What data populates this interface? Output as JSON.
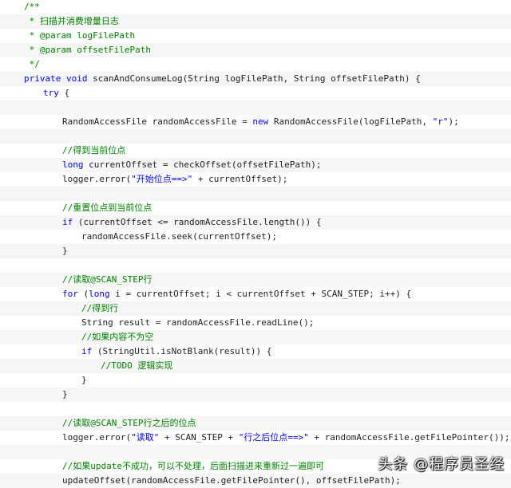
{
  "code_lines": [
    {
      "indent": 30,
      "parts": [
        {
          "text": "/**",
          "cls": "cm"
        }
      ]
    },
    {
      "indent": 30,
      "parts": [
        {
          "text": " * ",
          "cls": "cm"
        },
        {
          "text": "扫描并消费增量日志",
          "cls": "cm cn"
        }
      ]
    },
    {
      "indent": 30,
      "parts": [
        {
          "text": " * @param logFilePath",
          "cls": "cm"
        }
      ]
    },
    {
      "indent": 30,
      "parts": [
        {
          "text": " * @param offsetFilePath",
          "cls": "cm"
        }
      ]
    },
    {
      "indent": 30,
      "parts": [
        {
          "text": " */",
          "cls": "cm"
        }
      ]
    },
    {
      "indent": 30,
      "parts": [
        {
          "text": "private void ",
          "cls": "kw"
        },
        {
          "text": "scanAndConsumeLog(String logFilePath, String offsetFilePath) {",
          "cls": "t"
        }
      ]
    },
    {
      "indent": 54,
      "parts": [
        {
          "text": "try",
          "cls": "kw"
        },
        {
          "text": " {",
          "cls": "t"
        }
      ]
    },
    {
      "indent": 78,
      "parts": []
    },
    {
      "indent": 78,
      "parts": [
        {
          "text": "RandomAccessFile randomAccessFile = ",
          "cls": "t"
        },
        {
          "text": "new ",
          "cls": "kw"
        },
        {
          "text": "RandomAccessFile(logFilePath, ",
          "cls": "t"
        },
        {
          "text": "\"r\"",
          "cls": "kw"
        },
        {
          "text": ");",
          "cls": "t"
        }
      ]
    },
    {
      "indent": 78,
      "parts": []
    },
    {
      "indent": 78,
      "parts": [
        {
          "text": "//",
          "cls": "cm"
        },
        {
          "text": "得到当前位点",
          "cls": "cm cn"
        }
      ]
    },
    {
      "indent": 78,
      "parts": [
        {
          "text": "long ",
          "cls": "kw"
        },
        {
          "text": "currentOffset = checkOffset(offsetFilePath);",
          "cls": "t"
        }
      ]
    },
    {
      "indent": 78,
      "parts": [
        {
          "text": "logger.error(",
          "cls": "t"
        },
        {
          "text": "\"",
          "cls": "kw"
        },
        {
          "text": "开始位点",
          "cls": "kw cn"
        },
        {
          "text": "==>\"",
          "cls": "kw"
        },
        {
          "text": " + currentOffset);",
          "cls": "t"
        }
      ]
    },
    {
      "indent": 78,
      "parts": []
    },
    {
      "indent": 78,
      "parts": [
        {
          "text": "//",
          "cls": "cm"
        },
        {
          "text": "重置位点到当前位点",
          "cls": "cm cn"
        }
      ]
    },
    {
      "indent": 78,
      "parts": [
        {
          "text": "if ",
          "cls": "kw"
        },
        {
          "text": "(currentOffset <= randomAccessFile.length()) {",
          "cls": "t"
        }
      ]
    },
    {
      "indent": 102,
      "parts": [
        {
          "text": "randomAccessFile.seek(currentOffset);",
          "cls": "t"
        }
      ]
    },
    {
      "indent": 78,
      "parts": [
        {
          "text": "}",
          "cls": "t"
        }
      ]
    },
    {
      "indent": 78,
      "parts": []
    },
    {
      "indent": 78,
      "parts": [
        {
          "text": "//",
          "cls": "cm"
        },
        {
          "text": "读取",
          "cls": "cm cn"
        },
        {
          "text": "@SCAN_STEP",
          "cls": "cm"
        },
        {
          "text": "行",
          "cls": "cm cn"
        }
      ]
    },
    {
      "indent": 78,
      "parts": [
        {
          "text": "for ",
          "cls": "kw"
        },
        {
          "text": "(",
          "cls": "t"
        },
        {
          "text": "long ",
          "cls": "kw"
        },
        {
          "text": "i = currentOffset; i < currentOffset + SCAN_STEP; i++) {",
          "cls": "t"
        }
      ]
    },
    {
      "indent": 102,
      "parts": [
        {
          "text": "//",
          "cls": "cm"
        },
        {
          "text": "得到行",
          "cls": "cm cn"
        }
      ]
    },
    {
      "indent": 102,
      "parts": [
        {
          "text": "String result = randomAccessFile.readLine();",
          "cls": "t"
        }
      ]
    },
    {
      "indent": 102,
      "parts": [
        {
          "text": "//",
          "cls": "cm"
        },
        {
          "text": "如果内容不为空",
          "cls": "cm cn"
        }
      ]
    },
    {
      "indent": 102,
      "parts": [
        {
          "text": "if ",
          "cls": "kw"
        },
        {
          "text": "(StringUtil.isNotBlank(result)) {",
          "cls": "t"
        }
      ]
    },
    {
      "indent": 126,
      "parts": [
        {
          "text": "//TODO ",
          "cls": "cm"
        },
        {
          "text": "逻辑实现",
          "cls": "cm cn"
        }
      ]
    },
    {
      "indent": 102,
      "parts": [
        {
          "text": "}",
          "cls": "t"
        }
      ]
    },
    {
      "indent": 78,
      "parts": [
        {
          "text": "}",
          "cls": "t"
        }
      ]
    },
    {
      "indent": 78,
      "parts": []
    },
    {
      "indent": 78,
      "parts": [
        {
          "text": "//",
          "cls": "cm"
        },
        {
          "text": "读取",
          "cls": "cm cn"
        },
        {
          "text": "@SCAN_STEP",
          "cls": "cm"
        },
        {
          "text": "行之后的位点",
          "cls": "cm cn"
        }
      ]
    },
    {
      "indent": 78,
      "parts": [
        {
          "text": "logger.error(",
          "cls": "t"
        },
        {
          "text": "\"",
          "cls": "kw"
        },
        {
          "text": "读取",
          "cls": "kw cn"
        },
        {
          "text": "\"",
          "cls": "kw"
        },
        {
          "text": " + SCAN_STEP + ",
          "cls": "t"
        },
        {
          "text": "\"",
          "cls": "kw"
        },
        {
          "text": "行之后位点",
          "cls": "kw cn"
        },
        {
          "text": "==>\"",
          "cls": "kw"
        },
        {
          "text": " + randomAccessFile.getFilePointer());",
          "cls": "t"
        }
      ]
    },
    {
      "indent": 78,
      "parts": []
    },
    {
      "indent": 78,
      "parts": [
        {
          "text": "//",
          "cls": "cm"
        },
        {
          "text": "如果",
          "cls": "cm cn"
        },
        {
          "text": "update",
          "cls": "cm"
        },
        {
          "text": "不成功，可以不处理，后面扫描进来重新过一遍即可",
          "cls": "cm cn"
        }
      ]
    },
    {
      "indent": 78,
      "parts": [
        {
          "text": "updateOffset(randomAccessFile.getFilePointer(), offsetFilePath);",
          "cls": "t"
        }
      ]
    }
  ],
  "watermark": "头条 @程序员圣经"
}
